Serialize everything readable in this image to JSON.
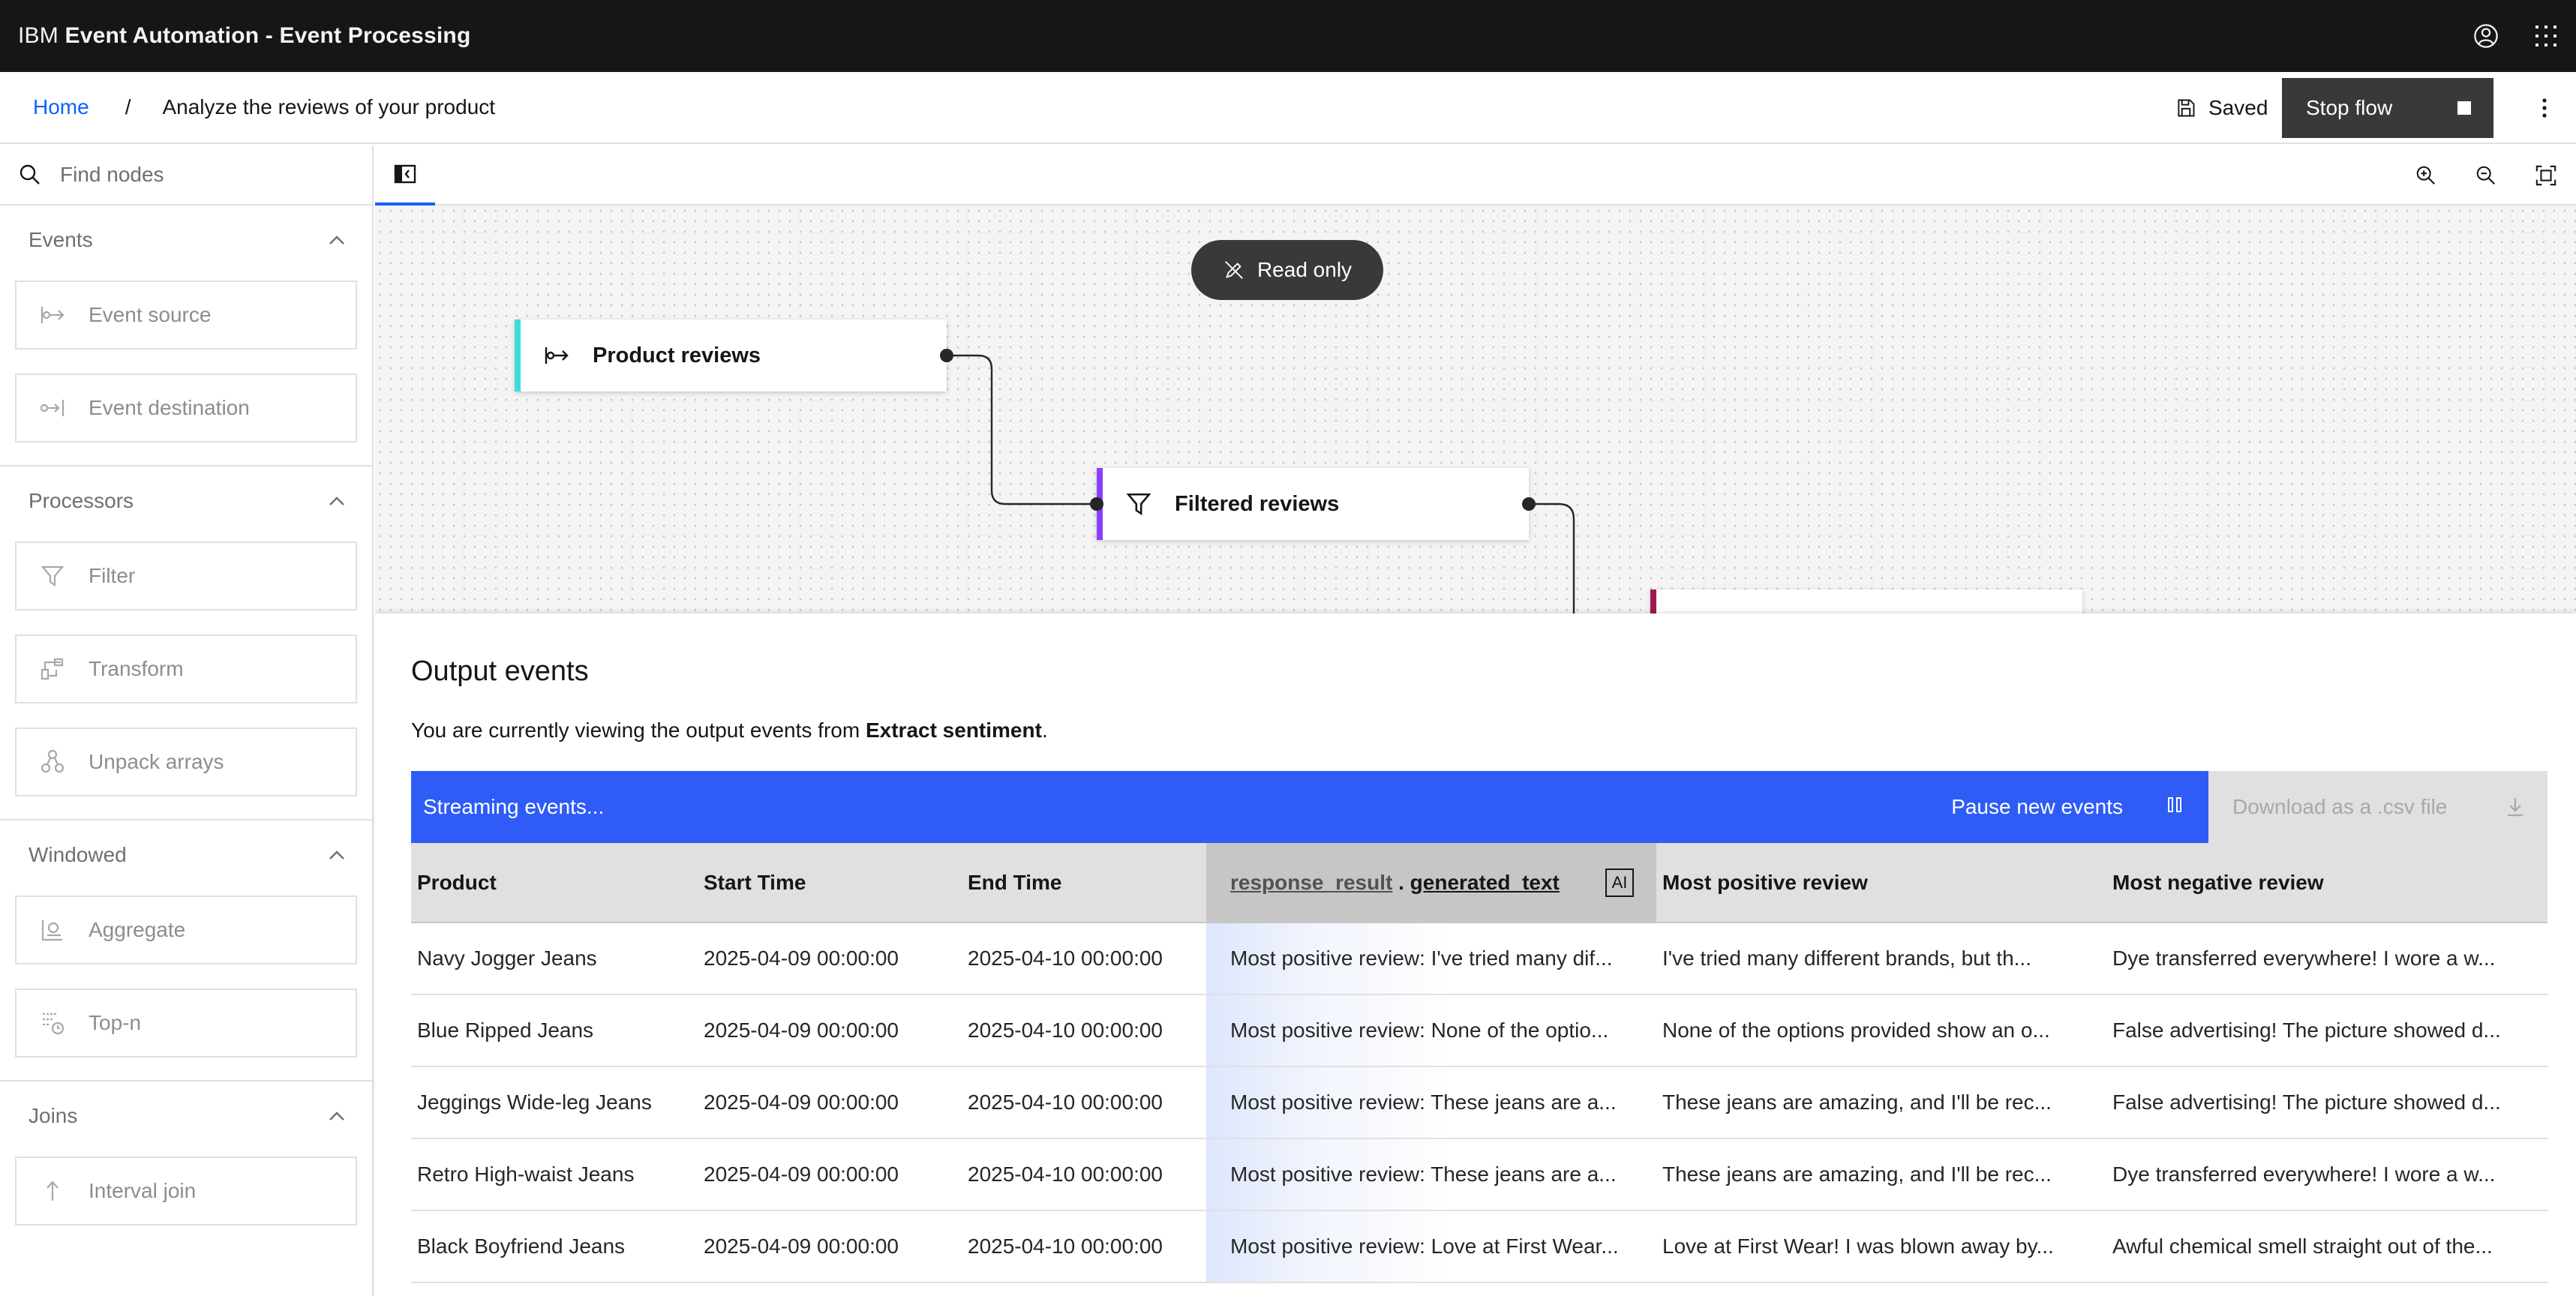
{
  "app": {
    "brand_prefix": "IBM",
    "brand_name": "Event Automation - Event Processing"
  },
  "breadcrumb": {
    "home": "Home",
    "separator": "/",
    "current": "Analyze the reviews of your product"
  },
  "header": {
    "saved_label": "Saved",
    "stop_flow_label": "Stop flow"
  },
  "sidebar": {
    "search_placeholder": "Find nodes",
    "categories": [
      {
        "label": "Events",
        "items": [
          "Event source",
          "Event destination"
        ]
      },
      {
        "label": "Processors",
        "items": [
          "Filter",
          "Transform",
          "Unpack arrays"
        ]
      },
      {
        "label": "Windowed",
        "items": [
          "Aggregate",
          "Top-n"
        ]
      },
      {
        "label": "Joins",
        "items": [
          "Interval join"
        ]
      }
    ]
  },
  "canvas": {
    "readonly_label": "Read only",
    "nodes": [
      {
        "label": "Product reviews",
        "accent": "#3ddbd9",
        "icon": "event-source-icon"
      },
      {
        "label": "Filtered reviews",
        "accent": "#8a3ffc",
        "icon": "filter-icon"
      },
      {
        "label": "",
        "accent": "#9f1853",
        "icon": ""
      }
    ]
  },
  "output": {
    "title": "Output events",
    "desc_prefix": "You are currently viewing the output events from ",
    "desc_bold": "Extract sentiment",
    "desc_suffix": ".",
    "streaming_label": "Streaming events...",
    "pause_label": "Pause new events",
    "download_label": "Download as a .csv file",
    "columns": {
      "product": "Product",
      "start": "Start Time",
      "end": "End Time",
      "ai_prefix": "response_result",
      "ai_dot": " . ",
      "ai_field": "generated_text",
      "ai_badge": "AI",
      "positive": "Most positive review",
      "negative": "Most negative review"
    },
    "rows": [
      {
        "product": "Navy Jogger Jeans",
        "start": "2025-04-09 00:00:00",
        "end": "2025-04-10 00:00:00",
        "generated": "Most positive review: I've tried many dif...",
        "positive": "I've tried many different brands, but th...",
        "negative": "Dye transferred everywhere! I wore a w..."
      },
      {
        "product": "Blue Ripped Jeans",
        "start": "2025-04-09 00:00:00",
        "end": "2025-04-10 00:00:00",
        "generated": "Most positive review: None of the optio...",
        "positive": "None of the options provided show an o...",
        "negative": "False advertising! The picture showed d..."
      },
      {
        "product": "Jeggings Wide-leg Jeans",
        "start": "2025-04-09 00:00:00",
        "end": "2025-04-10 00:00:00",
        "generated": "Most positive review: These jeans are a...",
        "positive": "These jeans are amazing, and I'll be rec...",
        "negative": "False advertising! The picture showed d..."
      },
      {
        "product": "Retro High-waist Jeans",
        "start": "2025-04-09 00:00:00",
        "end": "2025-04-10 00:00:00",
        "generated": "Most positive review: These jeans are a...",
        "positive": "These jeans are amazing, and I'll be rec...",
        "negative": "Dye transferred everywhere! I wore a w..."
      },
      {
        "product": "Black Boyfriend Jeans",
        "start": "2025-04-09 00:00:00",
        "end": "2025-04-10 00:00:00",
        "generated": "Most positive review: Love at First Wear...",
        "positive": "Love at First Wear! I was blown away by...",
        "negative": "Awful chemical smell straight out of the..."
      }
    ]
  },
  "colors": {
    "accent_blue": "#0f62fe",
    "stream_blue": "#2f5cf6",
    "topbar": "#161616"
  }
}
